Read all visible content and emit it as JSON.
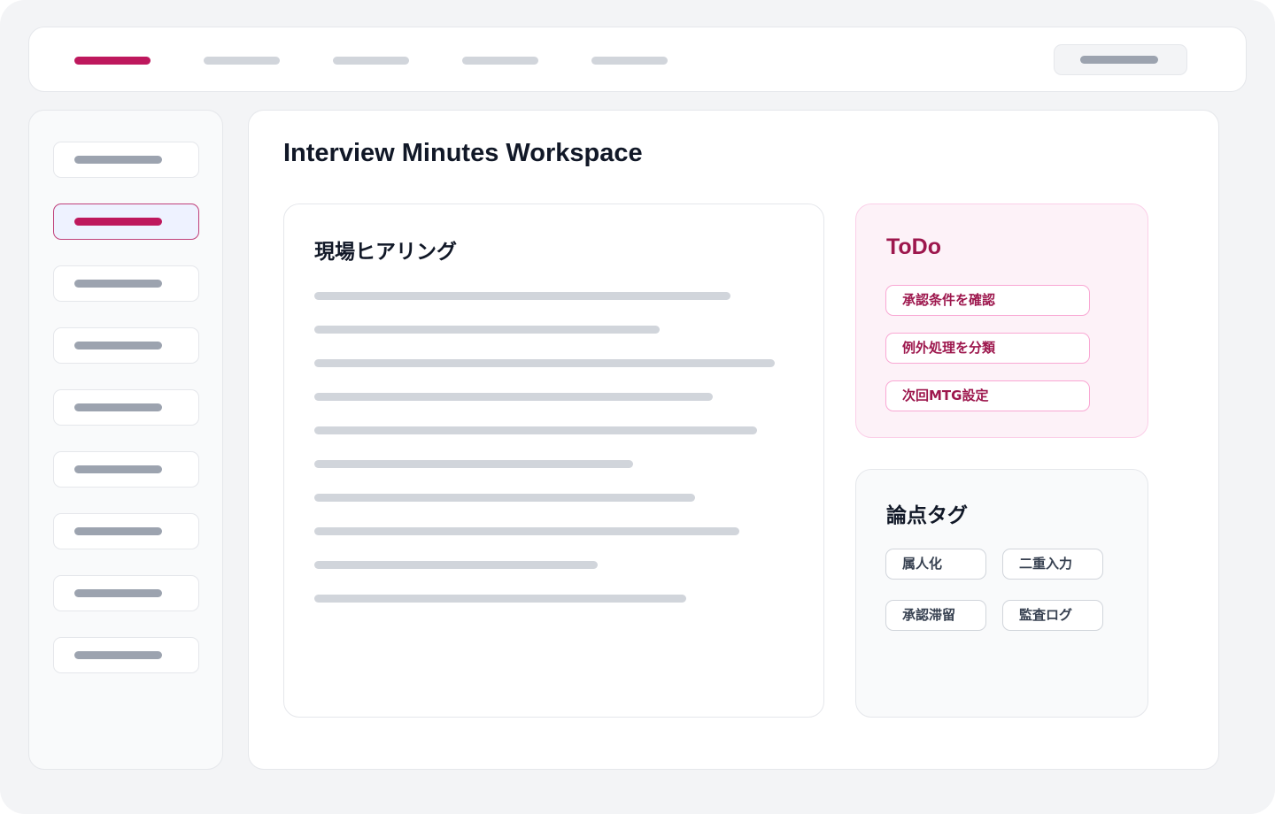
{
  "main": {
    "title": "Interview Minutes Workspace",
    "minutes": {
      "heading": "現場ヒアリング"
    },
    "todo": {
      "heading": "ToDo",
      "items": [
        "承認条件を確認",
        "例外処理を分類",
        "次回MTG設定"
      ]
    },
    "tags": {
      "heading": "論点タグ",
      "items": [
        "属人化",
        "二重入力",
        "承認滞留",
        "監査ログ"
      ]
    }
  },
  "colors": {
    "accent": "#be185d",
    "todo_text": "#9d174d",
    "todo_background": "#fdf2f8",
    "placeholder": "#d1d5db",
    "background": "#f3f4f6"
  }
}
